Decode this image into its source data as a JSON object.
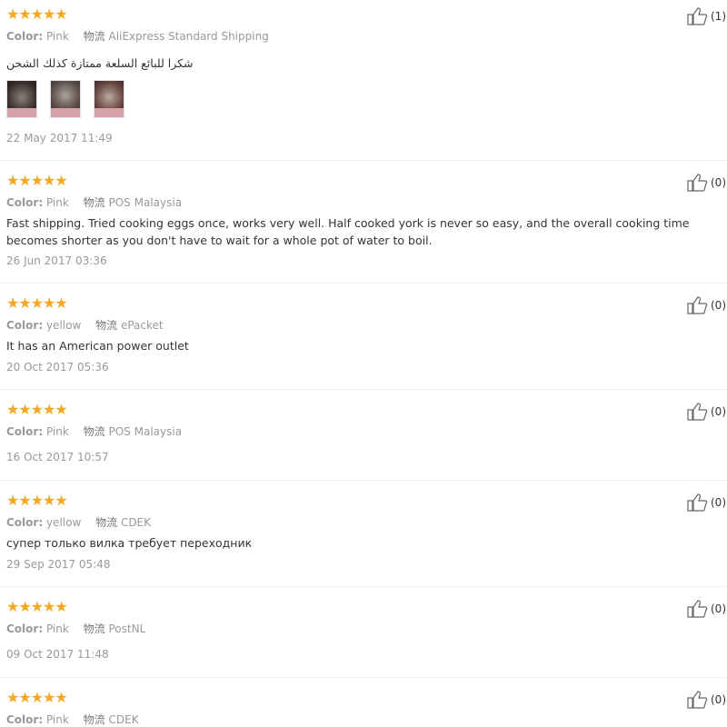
{
  "reviews": [
    {
      "stars": "★★★★★",
      "likes": "(1)",
      "color_label": "Color:",
      "color_value": "Pink",
      "logistics_label": "物流",
      "logistics_value": "AliExpress Standard Shipping",
      "text": "شكرا للبائع السلعة ممتازة كذلك الشحن",
      "photos": [
        "photo-1",
        "photo-2",
        "photo-3"
      ],
      "date": "22 May 2017 11:49"
    },
    {
      "stars": "★★★★★",
      "likes": "(0)",
      "color_label": "Color:",
      "color_value": "Pink",
      "logistics_label": "物流",
      "logistics_value": "POS Malaysia",
      "text": "Fast shipping. Tried cooking eggs once, works very well. Half cooked york is never so easy, and the overall cooking time becomes shorter as you don't have to wait for a whole pot of water to boil.",
      "date": "26 Jun 2017 03:36"
    },
    {
      "stars": "★★★★★",
      "likes": "(0)",
      "color_label": "Color:",
      "color_value": "yellow",
      "logistics_label": "物流",
      "logistics_value": "ePacket",
      "text": "It has an American power outlet",
      "date": "20 Oct 2017 05:36"
    },
    {
      "stars": "★★★★★",
      "likes": "(0)",
      "color_label": "Color:",
      "color_value": "Pink",
      "logistics_label": "物流",
      "logistics_value": "POS Malaysia",
      "text": "",
      "date": "16 Oct 2017 10:57"
    },
    {
      "stars": "★★★★★",
      "likes": "(0)",
      "color_label": "Color:",
      "color_value": "yellow",
      "logistics_label": "物流",
      "logistics_value": "CDEK",
      "text": "супер только вилка требует переходник",
      "date": "29 Sep 2017 05:48"
    },
    {
      "stars": "★★★★★",
      "likes": "(0)",
      "color_label": "Color:",
      "color_value": "Pink",
      "logistics_label": "物流",
      "logistics_value": "PostNL",
      "text": "",
      "date": "09 Oct 2017 11:48"
    },
    {
      "stars": "★★★★★",
      "likes": "(0)",
      "color_label": "Color:",
      "color_value": "Pink",
      "logistics_label": "物流",
      "logistics_value": "CDEK",
      "text": "",
      "date": ""
    }
  ],
  "colors": {
    "star": "#f5a623",
    "meta_text": "#999999",
    "body_text": "#333333",
    "divider": "#eeeeee"
  },
  "icons": {
    "like": "thumbs-up-icon",
    "star": "star-icon"
  }
}
